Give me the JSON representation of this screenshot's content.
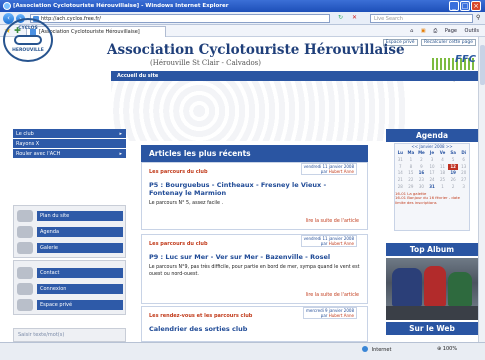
{
  "window": {
    "title": "[Association Cyclotouriste Hérouvillaise] - Windows Internet Explorer"
  },
  "browser": {
    "address": "http://ach.cyclos.free.fr/",
    "search_placeholder": "Live Search",
    "tab_title": "[Association Cyclotouriste Hérouvillaise]",
    "tools": [
      "Page",
      "Outils"
    ],
    "status_zone": "Internet",
    "zoom": "100%"
  },
  "site": {
    "top_links": [
      "Espace privé",
      "Recalculer cette page"
    ],
    "logo_text": "CYCLOS",
    "logo_subtext": "HEROUVILLE",
    "title": "Association Cyclotouriste Hérouvillaise",
    "subtitle": "(Hérouville St Clair - Calvados)",
    "partner": "FFC",
    "partner_sub": "Fédération Française de Cyclotourisme",
    "breadcrumb": "Accueil du site"
  },
  "nav": {
    "menu": [
      {
        "label": "Le club",
        "arrow": "▸"
      },
      {
        "label": "Rayons X",
        "arrow": ""
      },
      {
        "label": "Rouler avec l'ACH",
        "arrow": "▸"
      }
    ],
    "box1": [
      "Plan du site",
      "Agenda",
      "Galerie"
    ],
    "box2": [
      "Contact",
      "Connexion",
      "Espace privé"
    ],
    "search_box": "Saisir texte/mot(s)"
  },
  "main": {
    "heading": "Articles les plus récents",
    "articles": [
      {
        "category": "Les parcours du club",
        "date": "vendredi 11 janvier 2008",
        "author_prefix": "par",
        "author": "Hubert Anne",
        "title": "P5 : Bourguebus - Cintheaux - Fresney le Vieux - Fontenay le Marmion",
        "body": "Le parcours N° 5, assez facile .",
        "more": "lire la suite de l'article"
      },
      {
        "category": "Les parcours du club",
        "date": "vendredi 11 janvier 2008",
        "author_prefix": "par",
        "author": "Hubert Anne",
        "title": "P9 : Luc sur Mer - Ver sur Mer - Bazenville - Rosel",
        "body": "Le parcours N°9, pas très difficile, pour partie en bord de mer, sympa quand le vent est ouest ou nord-ouest.",
        "more": "lire la suite de l'article"
      },
      {
        "category": "Les rendez-vous et les parcours club",
        "date": "mercredi 9 janvier 2008",
        "author_prefix": "par",
        "author": "Hubert Anne",
        "title": "Calendrier des sorties club",
        "body": "",
        "more": ""
      }
    ]
  },
  "right": {
    "agenda_title": "Agenda",
    "month": "<< Janvier 2008 >>",
    "weekdays": [
      "Lu",
      "Ma",
      "Me",
      "Je",
      "Ve",
      "Sa",
      "Di"
    ],
    "days": [
      "31",
      "1",
      "2",
      "3",
      "4",
      "5",
      "6",
      "7",
      "8",
      "9",
      "10",
      "11",
      "12",
      "13",
      "14",
      "15",
      "16",
      "17",
      "18",
      "19",
      "20",
      "21",
      "22",
      "23",
      "24",
      "25",
      "26",
      "27",
      "28",
      "29",
      "30",
      "31",
      "1",
      "2",
      "3"
    ],
    "current_day": "12",
    "events": [
      "16-01 La galette",
      "16-01 Bonjour du 16 février - date limite des inscriptions"
    ],
    "album_title": "Top Album",
    "web_title": "Sur le Web"
  }
}
